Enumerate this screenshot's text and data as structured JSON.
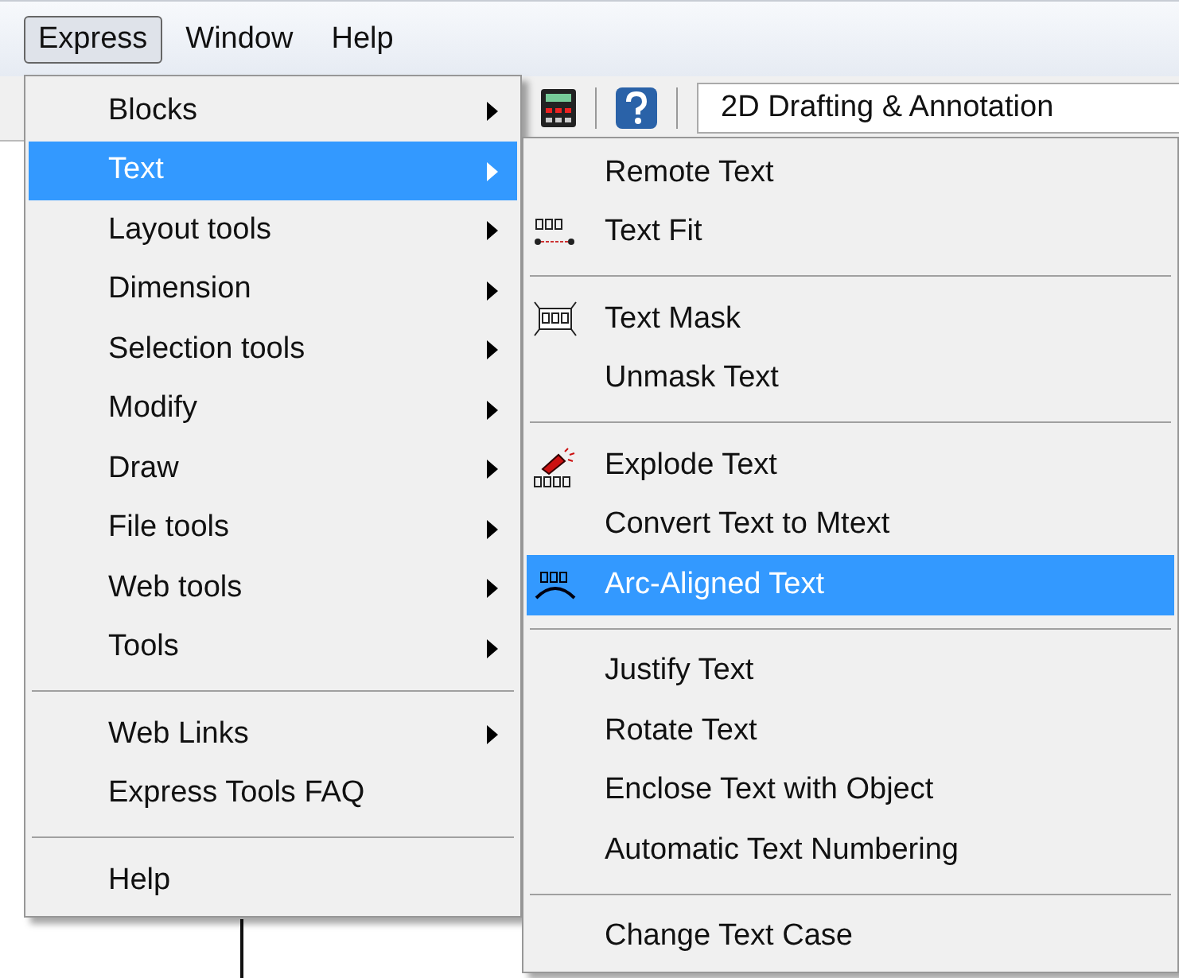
{
  "menubar": [
    {
      "label": "Express",
      "selected": true
    },
    {
      "label": "Window",
      "selected": false
    },
    {
      "label": "Help",
      "selected": false
    }
  ],
  "toolbar": {
    "workspace": "2D Drafting & Annotation"
  },
  "express_menu": [
    {
      "kind": "item",
      "label": "Blocks",
      "submenu": true,
      "selected": false
    },
    {
      "kind": "item",
      "label": "Text",
      "submenu": true,
      "selected": true
    },
    {
      "kind": "item",
      "label": "Layout tools",
      "submenu": true,
      "selected": false
    },
    {
      "kind": "item",
      "label": "Dimension",
      "submenu": true,
      "selected": false
    },
    {
      "kind": "item",
      "label": "Selection tools",
      "submenu": true,
      "selected": false
    },
    {
      "kind": "item",
      "label": "Modify",
      "submenu": true,
      "selected": false
    },
    {
      "kind": "item",
      "label": "Draw",
      "submenu": true,
      "selected": false
    },
    {
      "kind": "item",
      "label": "File tools",
      "submenu": true,
      "selected": false
    },
    {
      "kind": "item",
      "label": "Web tools",
      "submenu": true,
      "selected": false
    },
    {
      "kind": "item",
      "label": "Tools",
      "submenu": true,
      "selected": false
    },
    {
      "kind": "separator"
    },
    {
      "kind": "item",
      "label": "Web Links",
      "submenu": true,
      "selected": false
    },
    {
      "kind": "item",
      "label": "Express Tools FAQ",
      "submenu": false,
      "selected": false
    },
    {
      "kind": "separator"
    },
    {
      "kind": "item",
      "label": "Help",
      "submenu": false,
      "selected": false
    }
  ],
  "text_submenu": [
    {
      "kind": "item",
      "label": "Remote Text",
      "selected": false
    },
    {
      "kind": "item",
      "label": "Text Fit",
      "selected": false
    },
    {
      "kind": "separator"
    },
    {
      "kind": "item",
      "label": "Text Mask",
      "selected": false
    },
    {
      "kind": "item",
      "label": "Unmask Text",
      "selected": false
    },
    {
      "kind": "separator"
    },
    {
      "kind": "item",
      "label": "Explode Text",
      "selected": false
    },
    {
      "kind": "item",
      "label": "Convert Text to Mtext",
      "selected": false
    },
    {
      "kind": "item",
      "label": "Arc-Aligned Text",
      "selected": true
    },
    {
      "kind": "separator"
    },
    {
      "kind": "item",
      "label": "Justify Text",
      "selected": false
    },
    {
      "kind": "item",
      "label": "Rotate Text",
      "selected": false
    },
    {
      "kind": "item",
      "label": "Enclose Text with Object",
      "selected": false
    },
    {
      "kind": "item",
      "label": "Automatic Text Numbering",
      "selected": false
    },
    {
      "kind": "separator"
    },
    {
      "kind": "item",
      "label": "Change Text Case",
      "selected": false
    }
  ]
}
